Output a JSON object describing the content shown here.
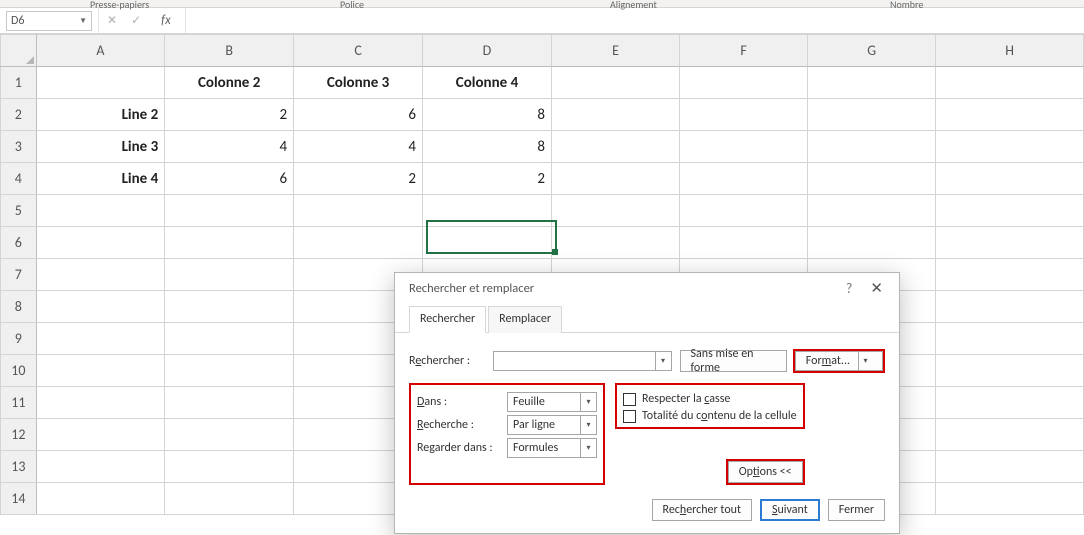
{
  "ribbon_groups": {
    "g1": "Presse-papiers",
    "g2": "Police",
    "g3": "Alignement",
    "g4": "Nombre"
  },
  "namebox": "D6",
  "fx": "fx",
  "columns": [
    "A",
    "B",
    "C",
    "D",
    "E",
    "F",
    "G",
    "H"
  ],
  "rows": [
    "1",
    "2",
    "3",
    "4",
    "5",
    "6",
    "7",
    "8",
    "9",
    "10",
    "11",
    "12",
    "13",
    "14"
  ],
  "cells": {
    "B1": "Colonne 2",
    "C1": "Colonne 3",
    "D1": "Colonne 4",
    "A2": "Line 2",
    "B2": "2",
    "C2": "6",
    "D2": "8",
    "A3": "Line 3",
    "B3": "4",
    "C3": "4",
    "D3": "8",
    "A4": "Line 4",
    "B4": "6",
    "C4": "2",
    "D4": "2"
  },
  "dialog": {
    "title": "Rechercher et remplacer",
    "tab_find": "Rechercher",
    "tab_replace": "Remplacer",
    "find_label": "Rechercher :",
    "find_value": "",
    "no_format": "Sans mise en forme",
    "format_btn": "Format...",
    "in_label": "Dans :",
    "in_value": "Feuille",
    "search_label": "Recherche :",
    "search_value": "Par ligne",
    "lookin_label": "Regarder dans :",
    "lookin_value": "Formules",
    "match_case": "Respecter la casse",
    "match_whole": "Totalité du contenu de la cellule",
    "options": "Options <<",
    "find_all": "Rechercher tout",
    "find_next": "Suivant",
    "close": "Fermer"
  }
}
